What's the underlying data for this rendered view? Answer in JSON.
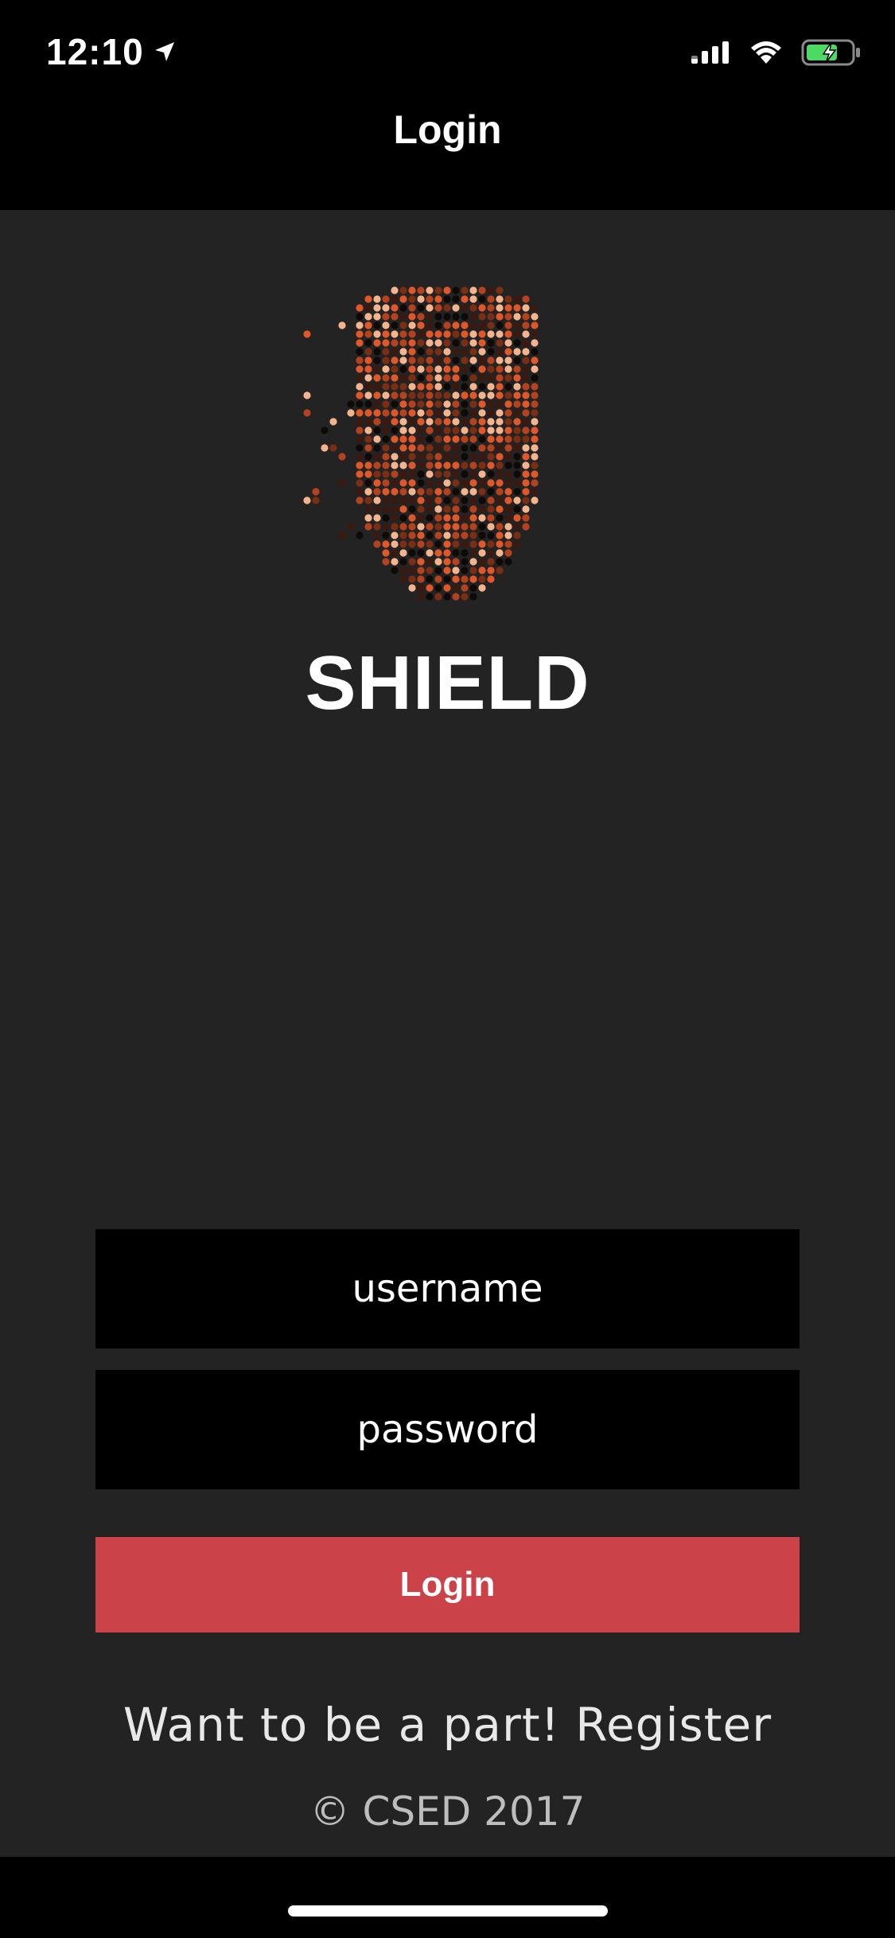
{
  "status_bar": {
    "time": "12:10",
    "icons": [
      "location-arrow-icon",
      "cellular-signal-icon",
      "wifi-icon",
      "battery-charging-icon"
    ]
  },
  "nav": {
    "title": "Login"
  },
  "logo": {
    "icon": "shield-pixel-icon",
    "brand": "SHIELD",
    "colors": [
      "#e0582a",
      "#b5421e",
      "#f4b58e",
      "#7a2e14",
      "#3a1a10",
      "#0e0a08"
    ]
  },
  "form": {
    "username_placeholder": "username",
    "password_placeholder": "password",
    "login_label": "Login"
  },
  "footer": {
    "register_text": "Want to be a part! Register",
    "copyright": "© CSED 2017"
  },
  "colors": {
    "background": "#232323",
    "bars": "#000000",
    "accent": "#cc4249",
    "field": "#000000"
  }
}
